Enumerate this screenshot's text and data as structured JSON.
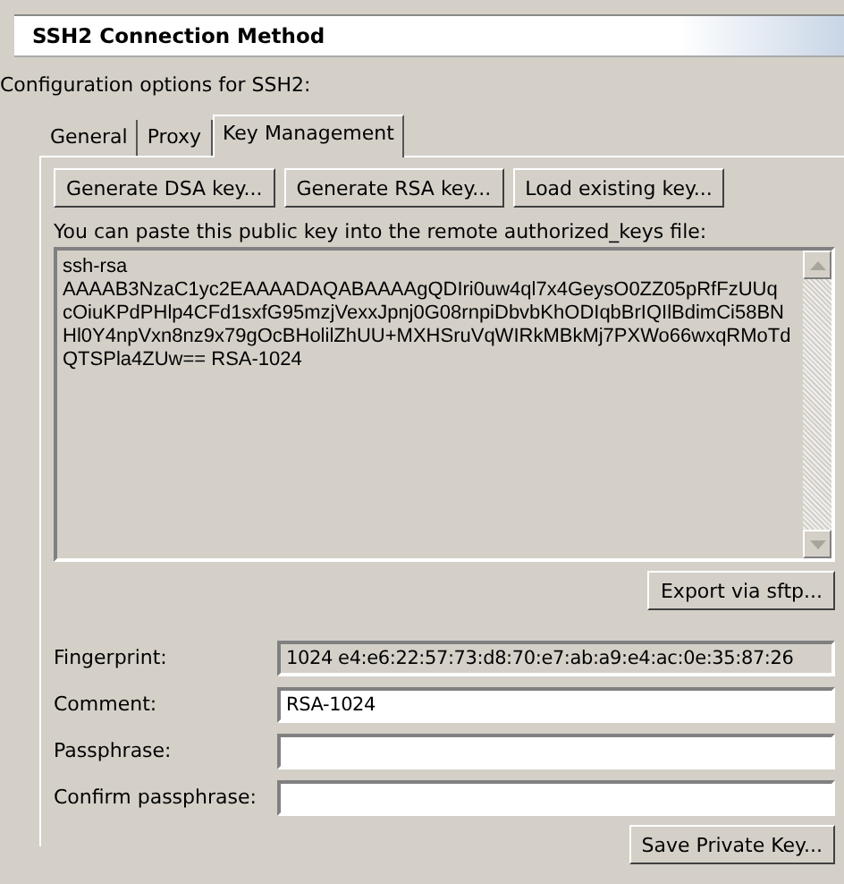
{
  "header": {
    "title": "SSH2 Connection Method"
  },
  "description": "Configuration options for SSH2:",
  "tabs": [
    {
      "label": "General",
      "selected": false
    },
    {
      "label": "Proxy",
      "selected": false
    },
    {
      "label": "Key Management",
      "selected": true
    }
  ],
  "key_buttons": [
    "Generate DSA key...",
    "Generate RSA key...",
    "Load existing key..."
  ],
  "paste_hint": "You can paste this public key into the remote authorized_keys file:",
  "public_key": {
    "readonly": true,
    "value": "ssh-rsa\nAAAAB3NzaC1yc2EAAAADAQABAAAAgQDIri0uw4ql7x4GeysO0ZZ05pRfFzUUq\ncOiuKPdPHlp4CFd1sxfG95mzjVexxJpnj0G08rnpiDbvbKhODIqbBrIQIlBdimCi58BN\nHl0Y4npVxn8nz9x79gOcBHolilZhUU+MXHSruVqWIRkMBkMj7PXWo66wxqRMoTd\nQTSPla4ZUw== RSA-1024"
  },
  "export_button": "Export via sftp...",
  "fields": [
    {
      "label": "Fingerprint:",
      "value": "1024 e4:e6:22:57:73:d8:70:e7:ab:a9:e4:ac:0e:35:87:26",
      "readonly": true
    },
    {
      "label": "Comment:",
      "value": "RSA-1024",
      "readonly": false
    },
    {
      "label": "Passphrase:",
      "readonly": false
    },
    {
      "label": "Confirm passphrase:",
      "readonly": false
    }
  ],
  "save_button": "Save Private Key..."
}
